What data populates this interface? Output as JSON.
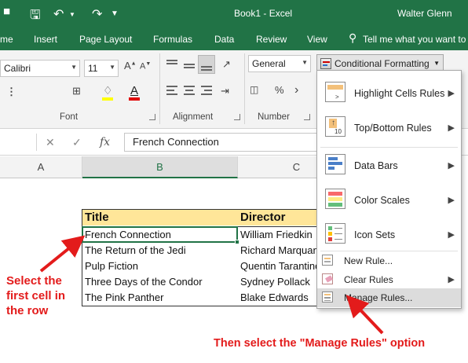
{
  "titlebar": {
    "title": "Book1  -  Excel",
    "user": "Walter Glenn",
    "qat_icons": [
      "excel-logo-icon",
      "save-icon",
      "undo-icon",
      "redo-icon",
      "customize-qat-icon"
    ]
  },
  "ribbon_tabs": {
    "home": "me",
    "insert": "Insert",
    "page_layout": "Page Layout",
    "formulas": "Formulas",
    "data": "Data",
    "review": "Review",
    "view": "View",
    "tell_me": "Tell me what you want to"
  },
  "ribbon": {
    "font_name": "Calibri",
    "font_size": "11",
    "number_format": "General",
    "conditional_formatting": "Conditional Formatting",
    "groups": {
      "font": "Font",
      "alignment": "Alignment",
      "number": "Number"
    }
  },
  "formula_bar": {
    "value": "French Connection"
  },
  "columns": {
    "a": "A",
    "b": "B",
    "c": "C"
  },
  "table": {
    "headers": {
      "title": "Title",
      "director": "Director"
    },
    "rows": [
      {
        "title": "French Connection",
        "director": "William Friedkin"
      },
      {
        "title": "The Return of the Jedi",
        "director": "Richard Marquand"
      },
      {
        "title": "Pulp Fiction",
        "director": "Quentin Tarantino"
      },
      {
        "title": "Three Days of the Condor",
        "director": "Sydney Pollack"
      },
      {
        "title": "The Pink Panther",
        "director": "Blake Edwards"
      }
    ]
  },
  "cf_menu": {
    "items": [
      {
        "label": "Highlight Cells Rules",
        "icon": "highlight-cells-rules-icon",
        "submenu": true
      },
      {
        "label": "Top/Bottom Rules",
        "icon": "top-bottom-rules-icon",
        "submenu": true
      },
      {
        "label": "Data Bars",
        "icon": "data-bars-icon",
        "submenu": true
      },
      {
        "label": "Color Scales",
        "icon": "color-scales-icon",
        "submenu": true
      },
      {
        "label": "Icon Sets",
        "icon": "icon-sets-icon",
        "submenu": true
      },
      {
        "label": "New Rule...",
        "icon": "new-rule-icon",
        "submenu": false
      },
      {
        "label": "Clear Rules",
        "icon": "clear-rules-icon",
        "submenu": true
      },
      {
        "label": "Manage Rules...",
        "icon": "manage-rules-icon",
        "submenu": false,
        "highlighted": true
      }
    ]
  },
  "annotations": {
    "left": [
      "Select the",
      "first cell in",
      "the row"
    ],
    "bottom": "Then select the \"Manage Rules\" option",
    "color": "#e31b1b"
  },
  "colors": {
    "excel_green": "#217346",
    "header_fill": "#ffe699",
    "menu_highlight": "#dcdcdc"
  }
}
